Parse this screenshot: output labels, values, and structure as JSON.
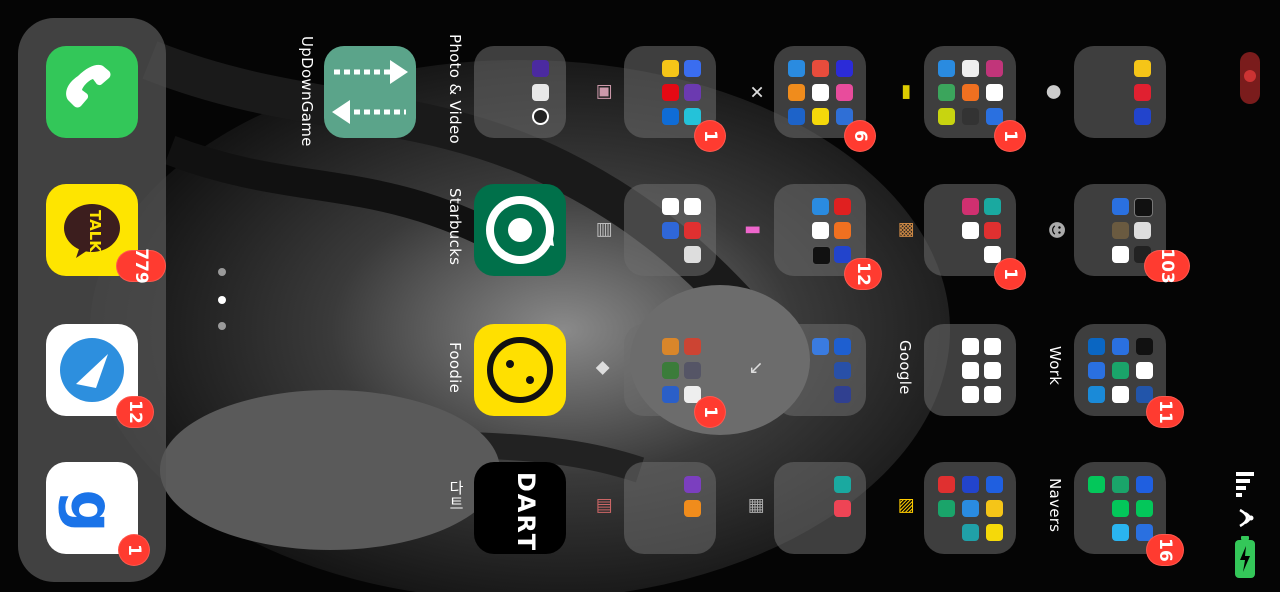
{
  "dock": {
    "apps": [
      {
        "name": "Phone",
        "icon": "phone-icon",
        "badge": ""
      },
      {
        "name": "KakaoTalk",
        "icon_text": "TALK",
        "badge": "779"
      },
      {
        "name": "Messaging",
        "icon": "paper-plane-icon",
        "badge": "12"
      },
      {
        "name": "g app",
        "icon_text": "g",
        "badge": "1"
      }
    ]
  },
  "page_dots": {
    "count": 3,
    "active_index": 1
  },
  "row1": {
    "updown_label": "UpDownGame",
    "photo_video_label": "Photo & Video"
  },
  "row2": {
    "starbucks_label": "Starbucks",
    "foodie_label": "Foodie",
    "dart_label": "다트",
    "dart_icon_text": "DART"
  },
  "folders": {
    "f1": {
      "badge": "1"
    },
    "f2": {
      "badge": "6"
    },
    "f3": {
      "badge": "1"
    },
    "f4": {
      "badge": "12"
    },
    "f5": {
      "badge": "1"
    },
    "f6": {
      "badge": "103"
    },
    "f7": {
      "badge": "1"
    },
    "google_label": "Google",
    "work_label": "Work",
    "work_badge": "11",
    "navers_label": "Navers",
    "navers_badge": "16"
  },
  "status": {
    "battery": "charging",
    "wifi": "on",
    "signal_bars": 4
  },
  "colors": {
    "badge": "#ff3b30",
    "phone": "#33c759",
    "kakao": "#fee500",
    "starbucks": "#00704a",
    "foodie": "#ffe000",
    "updown": "#5ba48a"
  }
}
